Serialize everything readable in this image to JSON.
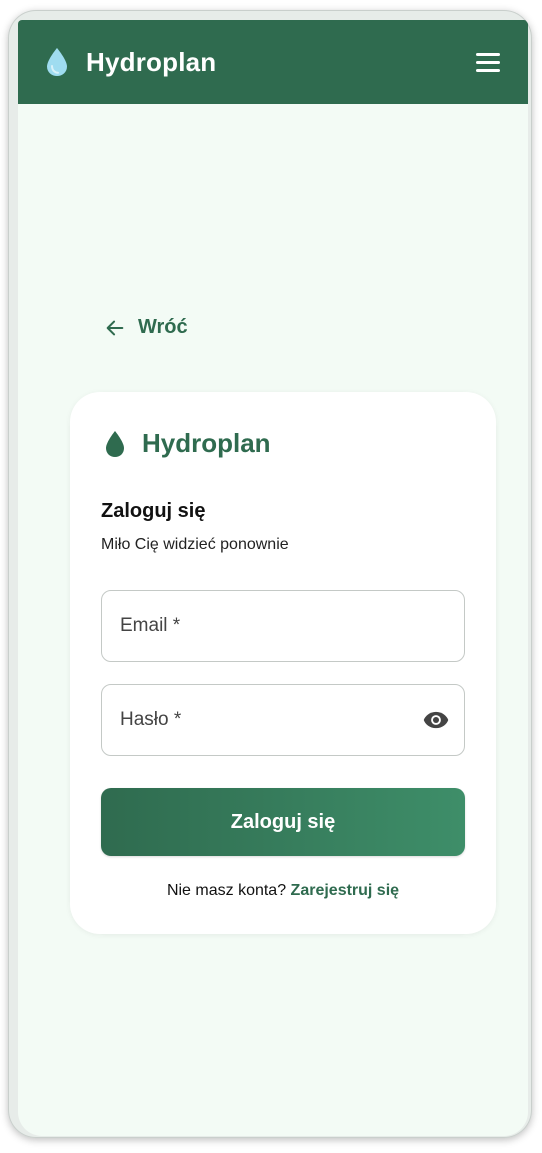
{
  "appbar": {
    "title": "Hydroplan",
    "logo_icon": "water-drop-icon",
    "menu_icon": "hamburger-menu-icon",
    "background": "#2f6b4f",
    "drop_color": "#9fdcf0"
  },
  "back": {
    "label": "Wróć",
    "icon": "arrow-left-icon"
  },
  "card": {
    "brand": "Hydroplan",
    "brand_icon": "water-drop-icon",
    "heading": "Zaloguj się",
    "subheading": "Miło Cię widzieć ponownie",
    "email_label": "Email *",
    "password_label": "Hasło *",
    "eye_icon": "eye-icon",
    "submit_label": "Zaloguj się",
    "signup_prompt": "Nie masz konta? ",
    "signup_link": "Zarejestruj się"
  },
  "colors": {
    "primary": "#2f6b4f",
    "background": "#f3fbf5",
    "card": "#ffffff"
  }
}
